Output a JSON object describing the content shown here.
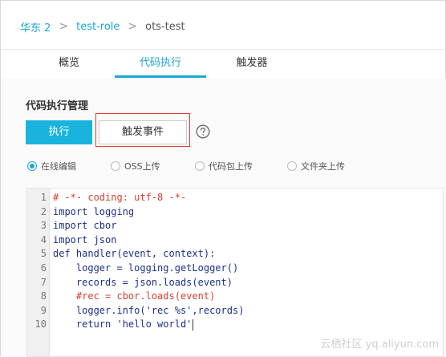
{
  "breadcrumb": {
    "items": [
      "华东 2",
      "test-role",
      "ots-test"
    ],
    "separator": ">"
  },
  "tabs": [
    {
      "label": "概览",
      "active": false
    },
    {
      "label": "代码执行",
      "active": true
    },
    {
      "label": "触发器",
      "active": false
    }
  ],
  "section": {
    "title": "代码执行管理",
    "execute_button": "执行",
    "trigger_event_button": "触发事件",
    "help_icon": "question-circle-icon"
  },
  "source_options": [
    {
      "label": "在线编辑",
      "selected": true
    },
    {
      "label": "OSS上传",
      "selected": false
    },
    {
      "label": "代码包上传",
      "selected": false
    },
    {
      "label": "文件夹上传",
      "selected": false
    }
  ],
  "editor": {
    "lines": [
      {
        "num": "1",
        "text": "# -*- coding: utf-8 -*-"
      },
      {
        "num": "2",
        "text": "import logging"
      },
      {
        "num": "3",
        "text": "import cbor"
      },
      {
        "num": "4",
        "text": "import json"
      },
      {
        "num": "5",
        "text": "def handler(event, context):"
      },
      {
        "num": "6",
        "text": "    logger = logging.getLogger()"
      },
      {
        "num": "7",
        "text": "    records = json.loads(event)"
      },
      {
        "num": "8",
        "text": "    #rec = cbor.loads(event)"
      },
      {
        "num": "9",
        "text": "    logger.info('rec %s',records)"
      },
      {
        "num": "10",
        "text": "    return 'hello world'"
      }
    ]
  },
  "colors": {
    "accent": "#1aa7d6",
    "execute_button_bg": "#1ab3dd",
    "highlight_border": "#e53935",
    "comment": "#d63f2f"
  },
  "watermark": "云栖社区 yq.aliyun.com"
}
